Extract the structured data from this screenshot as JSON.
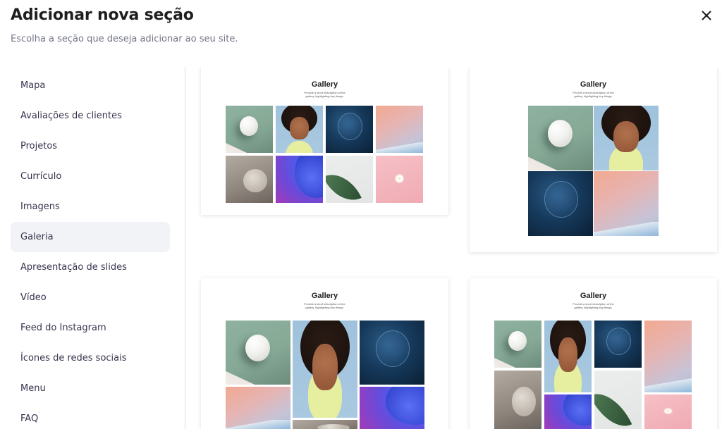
{
  "modal": {
    "title": "Adicionar nova seção",
    "subtitle": "Escolha a seção que deseja adicionar ao seu site."
  },
  "sidebar": {
    "items": [
      {
        "label": "Mapa",
        "active": false
      },
      {
        "label": "Avaliações de clientes",
        "active": false
      },
      {
        "label": "Projetos",
        "active": false
      },
      {
        "label": "Currículo",
        "active": false
      },
      {
        "label": "Imagens",
        "active": false
      },
      {
        "label": "Galeria",
        "active": true
      },
      {
        "label": "Apresentação de slides",
        "active": false
      },
      {
        "label": "Vídeo",
        "active": false
      },
      {
        "label": "Feed do Instagram",
        "active": false
      },
      {
        "label": "Ícones de redes sociais",
        "active": false
      },
      {
        "label": "Menu",
        "active": false
      },
      {
        "label": "FAQ",
        "active": false
      }
    ]
  },
  "templates": [
    {
      "title": "Gallery",
      "description": "Provide a short description of the gallery, highlighting key things.",
      "layout": "grid-4x2"
    },
    {
      "title": "Gallery",
      "description": "Provide a short description of the gallery, highlighting key things.",
      "layout": "grid-2x2"
    },
    {
      "title": "Gallery",
      "description": "Provide a short description of the gallery, highlighting key things.",
      "layout": "masonry-3-col"
    },
    {
      "title": "Gallery",
      "description": "Provide a short description of the gallery, highlighting key things.",
      "layout": "masonry-4-col"
    }
  ],
  "icons": {
    "close": "close-icon"
  },
  "colors": {
    "active_item_bg": "#f2f3f6",
    "text_primary": "#1d1e20",
    "text_secondary": "#727586"
  }
}
